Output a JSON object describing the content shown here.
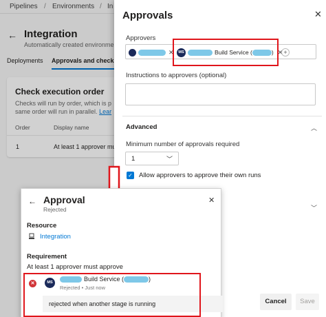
{
  "breadcrumbs": [
    "Pipelines",
    "Environments",
    "In"
  ],
  "page": {
    "title": "Integration",
    "subtitle": "Automatically created environme",
    "tabs": [
      "Deployments",
      "Approvals and checks"
    ]
  },
  "check_card": {
    "title": "Check execution order",
    "description": "Checks will run by order, which is p same order will run in parallel.",
    "link": "Lear",
    "columns": [
      "Order",
      "Display name"
    ],
    "rows": [
      {
        "order": "1",
        "name": "At least 1 approver mus"
      }
    ]
  },
  "approvals_panel": {
    "title": "Approvals",
    "approvers_label": "Approvers",
    "approver_initials": "MS",
    "approver_name": "Build Service (",
    "approver_name_end": ")",
    "instructions_label": "Instructions to approvers (optional)",
    "advanced_label": "Advanced",
    "min_label": "Minimum number of approvals required",
    "min_value": "1",
    "allow_label": "Allow approvers to approve their own runs",
    "cancel_label": "Cancel",
    "save_label": "Save"
  },
  "approval_popup": {
    "title": "Approval",
    "status": "Rejected",
    "resource_header": "Resource",
    "resource_name": "Integration",
    "requirement_header": "Requirement",
    "requirement_text": "At least 1 approver must approve",
    "approver_initials": "MS",
    "approver_name": "Build Service (",
    "approver_name_end": ")",
    "approver_meta": "Rejected • Just now",
    "comment": "rejected when another stage is running"
  },
  "colors": {
    "accent": "#0078d4",
    "highlight": "#e0151b",
    "redacted": "#7ec8e8",
    "rejected": "#d13438"
  }
}
